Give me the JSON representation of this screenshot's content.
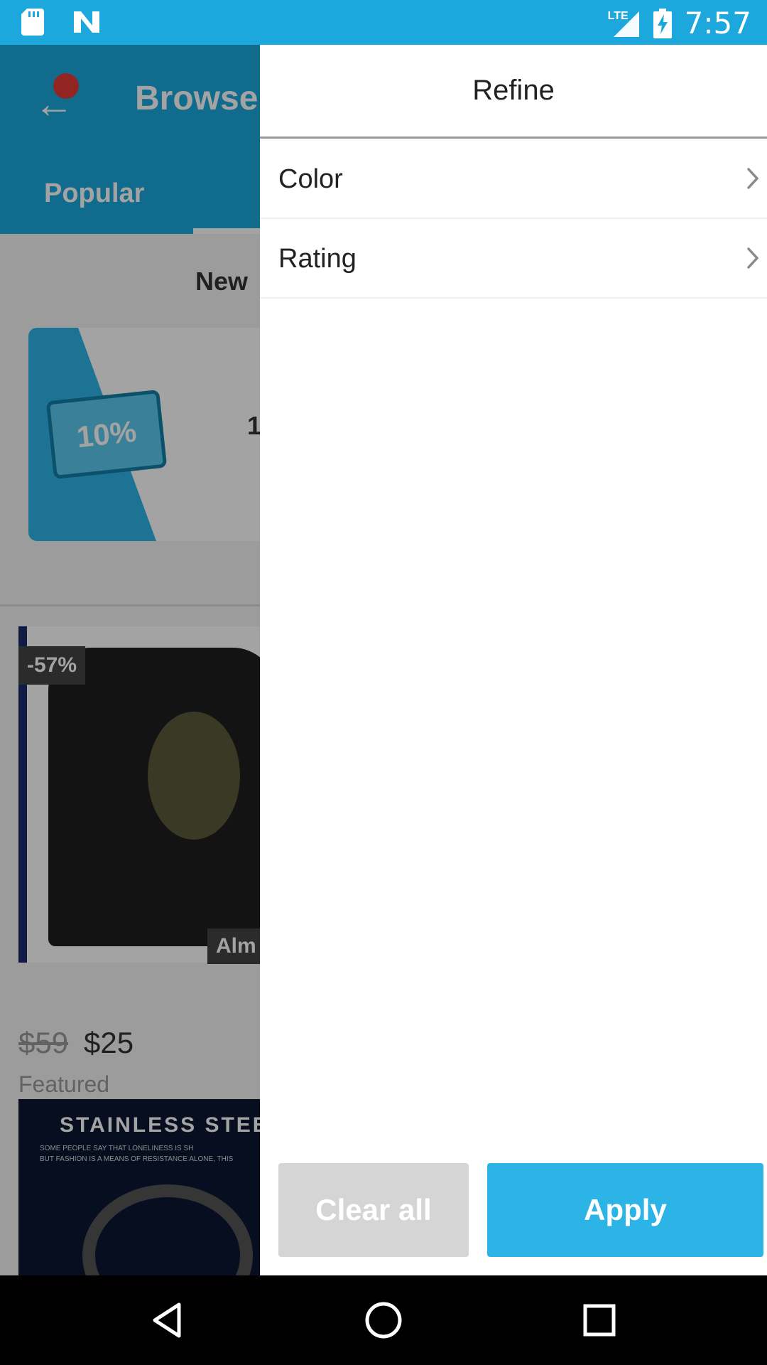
{
  "status_bar": {
    "time": "7:57",
    "network": "LTE",
    "icons": [
      "sd-card-icon",
      "n-logo-icon",
      "signal-icon",
      "battery-charging-icon"
    ]
  },
  "background": {
    "title": "Browse",
    "tab_active": "Popular",
    "section_heading": "New",
    "coupon_text": "10%",
    "coupon_caption_partial": "1",
    "product": {
      "discount_badge": "-57%",
      "overlay_badge_partial": "Alm",
      "old_price": "$59",
      "price": "$25",
      "tag": "Featured"
    },
    "second_product": {
      "banner_title": "STAINLESS STEEL",
      "banner_line1": "SOME PEOPLE SAY THAT LONELINESS IS SH",
      "banner_line2": "BUT FASHION IS A MEANS OF RESISTANCE ALONE, THIS"
    }
  },
  "drawer": {
    "title": "Refine",
    "filters": [
      {
        "label": "Color"
      },
      {
        "label": "Rating"
      }
    ],
    "clear_label": "Clear all",
    "apply_label": "Apply"
  },
  "colors": {
    "brand_blue": "#1ca8dd",
    "apply_blue": "#2db4e6",
    "clear_gray": "#d5d5d5"
  }
}
